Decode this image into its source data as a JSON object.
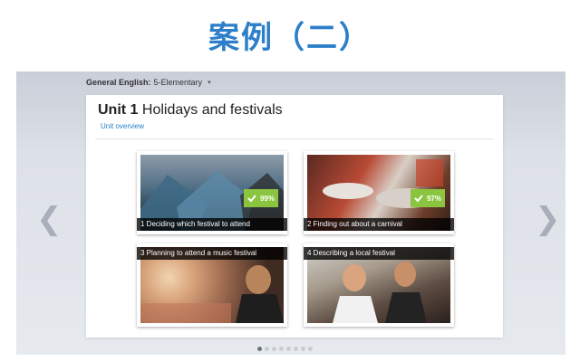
{
  "slide": {
    "title": "案例（二）"
  },
  "header": {
    "course_label": "General English:",
    "course_level": "5-Elementary"
  },
  "unit": {
    "number": "Unit 1",
    "name": "Holidays and festivals",
    "overview_link": "Unit overview"
  },
  "lessons": [
    {
      "caption": "1 Deciding which festival to attend",
      "progress": "99%",
      "completed": true
    },
    {
      "caption": "2 Finding out about a carnival",
      "progress": "97%",
      "completed": true
    },
    {
      "caption": "3 Planning to attend a music festival",
      "completed": false
    },
    {
      "caption": "4 Describing a local festival",
      "completed": false
    }
  ],
  "navigation": {
    "prev_glyph": "❮",
    "next_glyph": "❯"
  },
  "pager": {
    "count": 8,
    "active_index": 0
  },
  "colors": {
    "accent": "#2d7fc9",
    "badge": "#8bc53f"
  },
  "icons": {
    "badge": "checkmark-icon",
    "selector": "chevron-down-icon"
  }
}
